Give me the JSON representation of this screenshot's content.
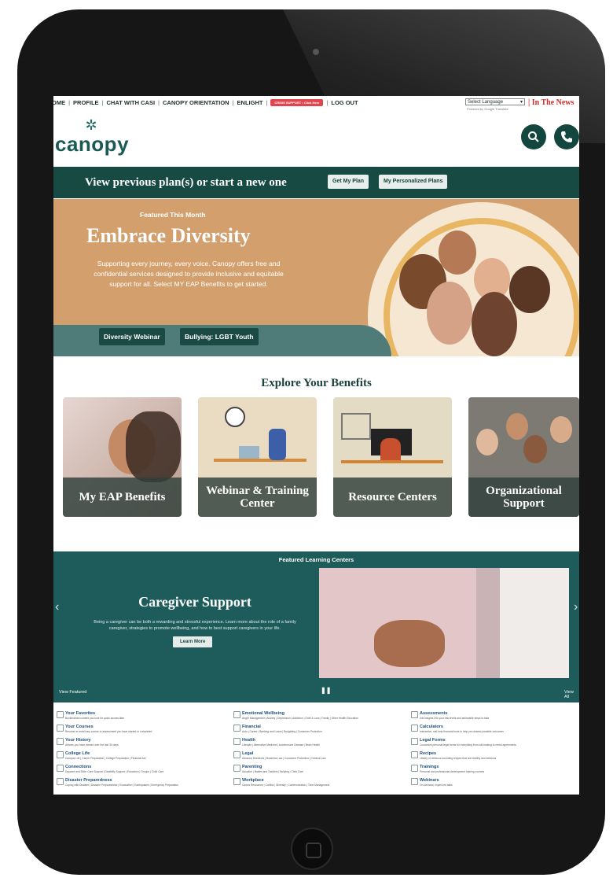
{
  "nav": {
    "links": [
      "OME",
      "PROFILE",
      "CHAT WITH CASI",
      "CANOPY ORIENTATION",
      "ENLIGHT"
    ],
    "crisis": "CRISIS SUPPORT • Click Here",
    "logout": "LOG OUT",
    "language": "Select Language",
    "powered_by": "Powered by Google Translate",
    "in_the_news": "| In The News"
  },
  "brand": {
    "logo_text": "canopy"
  },
  "plan_bar": {
    "text": "View previous plan(s) or start a new one",
    "get_plan": "Get My Plan",
    "personalized": "My Personalized Plans"
  },
  "hero": {
    "featured": "Featured This Month",
    "title": "Embrace Diversity",
    "description": "Supporting every journey, every voice. Canopy offers free and confidential services designed to provide inclusive and equitable support for all. Select MY EAP Benefits to get started.",
    "button1": "Diversity Webinar",
    "button2": "Bullying: LGBT Youth"
  },
  "explore": {
    "title": "Explore Your Benefits",
    "cards": [
      "My EAP Benefits",
      "Webinar & Training Center",
      "Resource Centers",
      "Organizational Support"
    ]
  },
  "featured": {
    "heading": "Featured Learning Centers",
    "title": "Caregiver Support",
    "description": "Being a caregiver can be both a rewarding and stressful experience. Learn more about the role of a family caregiver, strategies to promote wellbeing, and how to best support caregivers in your life.",
    "learn_more": "Learn More",
    "view_featured": "View Featured",
    "view_all": "View All"
  },
  "quick_links": {
    "col1": [
      {
        "title": "Your Favorites",
        "sub": "Bookmarked content you love for quick access later"
      },
      {
        "title": "Your Courses",
        "sub": "Resume or revisit any course or assessment you have started or completed"
      },
      {
        "title": "Your History",
        "sub": "Articles you have viewed over the last 30 days"
      },
      {
        "title": "College Life",
        "sub": "Campus Life | Career Preparation | College Preparation | Financial Aid"
      },
      {
        "title": "Connections",
        "sub": "Daycare and Elder Care Support | Disability Support | Education | Groups | Child Care"
      },
      {
        "title": "Disaster Preparedness",
        "sub": "Coping with Disaster | Disaster Preparedness | Evacuation | Earthquakes | Emergency Preparation"
      }
    ],
    "col2": [
      {
        "title": "Emotional Wellbeing",
        "sub": "Anger Management | Anxiety | Depression | Addiction | Grief & Loss | Family | Other Health Education"
      },
      {
        "title": "Financial",
        "sub": "Auto | Career | Banking and Loans | Budgeting | Consumer Protection"
      },
      {
        "title": "Health",
        "sub": "Lifestyle | Alternative Medicine | Autoimmune Disease | Brain Health"
      },
      {
        "title": "Legal",
        "sub": "Advance Directives | Business Law | Consumer Protection | Criminal Law"
      },
      {
        "title": "Parenting",
        "sub": "Adoption | Babies and Toddlers | Bullying | Child Care"
      },
      {
        "title": "Workplace",
        "sub": "Career Resources | Conflict | Diversity | Communication | Time Management"
      }
    ],
    "col3": [
      {
        "title": "Assessments",
        "sub": "Get insights into your risk levels and actionable steps to take"
      },
      {
        "title": "Calculators",
        "sub": "Interactive, self-help financial tools to help you assess possible outcomes"
      },
      {
        "title": "Legal Forms",
        "sub": "Customize personal legal forms for everything from will-making to rental agreements"
      },
      {
        "title": "Recipes",
        "sub": "Library of delicious-sounding recipes that are healthy and delicious"
      },
      {
        "title": "Trainings",
        "sub": "Personal and professional development training courses"
      },
      {
        "title": "Webinars",
        "sub": "On-demand, expert-led talks"
      }
    ]
  },
  "colors": {
    "brand_green": "#184a44",
    "hero_tan": "#d3a06d",
    "featured_teal": "#1d5c5b"
  }
}
